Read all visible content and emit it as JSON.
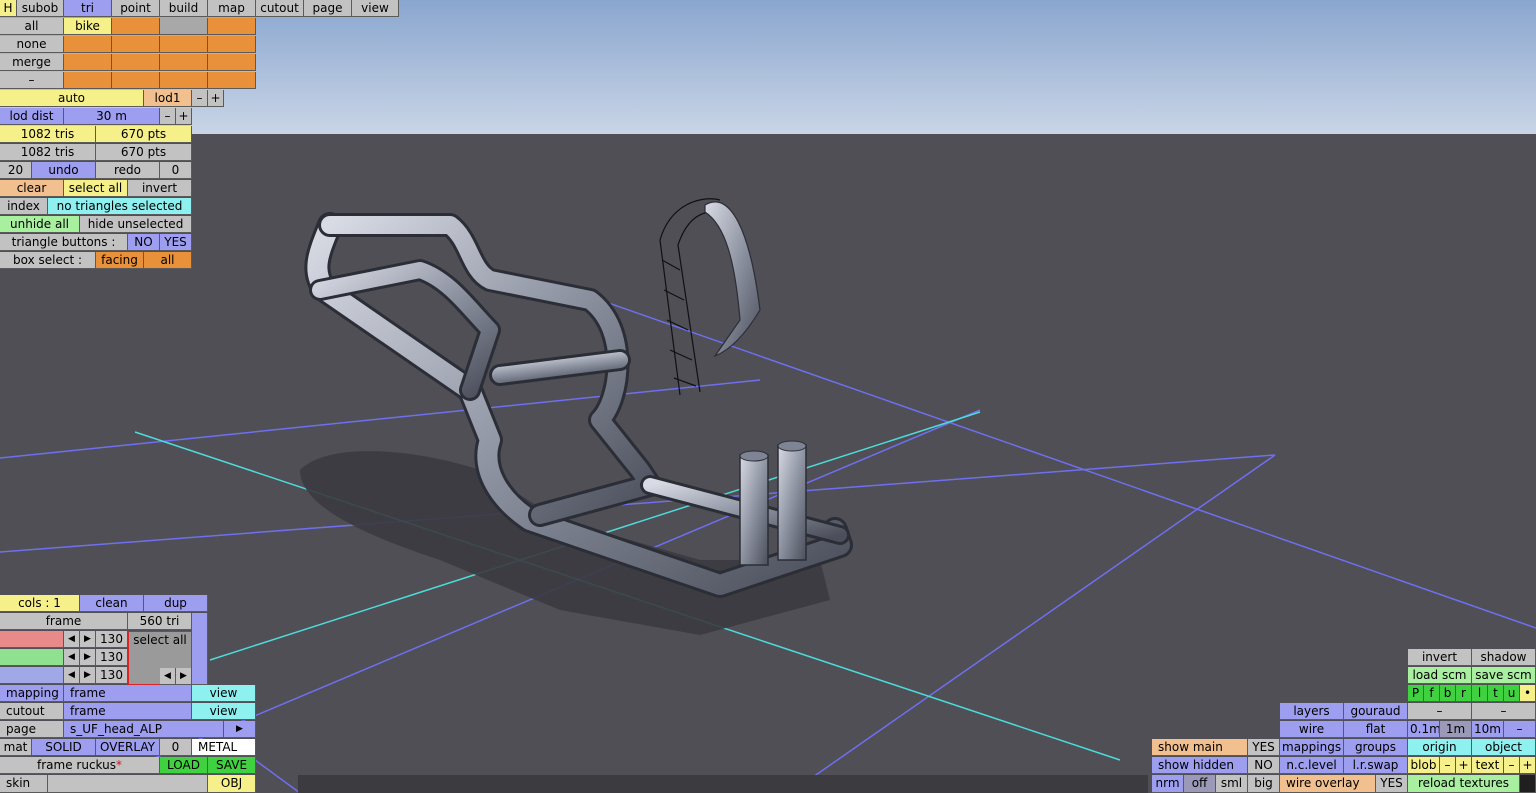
{
  "top_tabs": [
    "H",
    "subob",
    "tri",
    "point",
    "build",
    "map",
    "cutout",
    "page",
    "view"
  ],
  "obj_rows": {
    "all": "all",
    "none": "none",
    "merge": "merge",
    "dash": "–",
    "bike": "bike"
  },
  "lod": {
    "auto": "auto",
    "lod1": "lod1",
    "minus": "–",
    "plus": "+",
    "dist_label": "lod dist",
    "dist_value": "30 m"
  },
  "stats": {
    "tris1": "1082 tris",
    "pts1": "670 pts",
    "tris2": "1082 tris",
    "pts2": "670 pts"
  },
  "history": {
    "count": "20",
    "undo": "undo",
    "redo": "redo",
    "zero": "0"
  },
  "selection": {
    "clear": "clear",
    "select_all": "select all",
    "invert": "invert",
    "index": "index",
    "status": "no triangles selected",
    "unhide_all": "unhide all",
    "hide_unselected": "hide unselected",
    "tri_buttons_label": "triangle buttons :",
    "no": "NO",
    "yes": "YES",
    "box_select_label": "box select :",
    "facing": "facing",
    "all": "all"
  },
  "cols": {
    "label": "cols : 1",
    "clean": "clean",
    "dup": "dup",
    "frame": "frame",
    "tri_count": "560 tri",
    "v1": "130",
    "v2": "130",
    "v3": "130",
    "select_all": "select all"
  },
  "bottom_left": {
    "mapping": "mapping",
    "mapping_val": "frame",
    "mapping_view": "view",
    "cutout": "cutout",
    "cutout_val": "frame",
    "cutout_view": "view",
    "page": "page",
    "page_val": "s_UF_head_ALP",
    "mat": "mat",
    "solid": "SOLID",
    "overlay": "OVERLAY",
    "mat_num": "0",
    "metal": "METAL",
    "frame_name": "frame ruckus",
    "star": "*",
    "load": "LOAD",
    "save": "SAVE",
    "skin": "skin",
    "obj": "OBJ"
  },
  "bottom_right": {
    "invert": "invert",
    "shadow": "shadow",
    "load_scm": "load scm",
    "save_scm": "save scm",
    "letters": [
      "P",
      "f",
      "b",
      "r",
      "l",
      "t",
      "u",
      "•"
    ],
    "layers": "layers",
    "gouraud": "gouraud",
    "wire": "wire",
    "flat": "flat",
    "d1": "0.1m",
    "d2": "1m",
    "d3": "10m",
    "origin": "origin",
    "object": "object",
    "show_main": "show main",
    "show_main_yes": "YES",
    "mappings": "mappings",
    "groups": "groups",
    "show_hidden": "show hidden",
    "show_hidden_no": "NO",
    "nc_level": "n.c.level",
    "lr_swap": "l.r.swap",
    "blob": "blob",
    "text": "text",
    "nrm": "nrm",
    "off": "off",
    "sml": "sml",
    "big": "big",
    "wire_overlay": "wire overlay",
    "wire_overlay_yes": "YES",
    "reload_textures": "reload textures"
  }
}
